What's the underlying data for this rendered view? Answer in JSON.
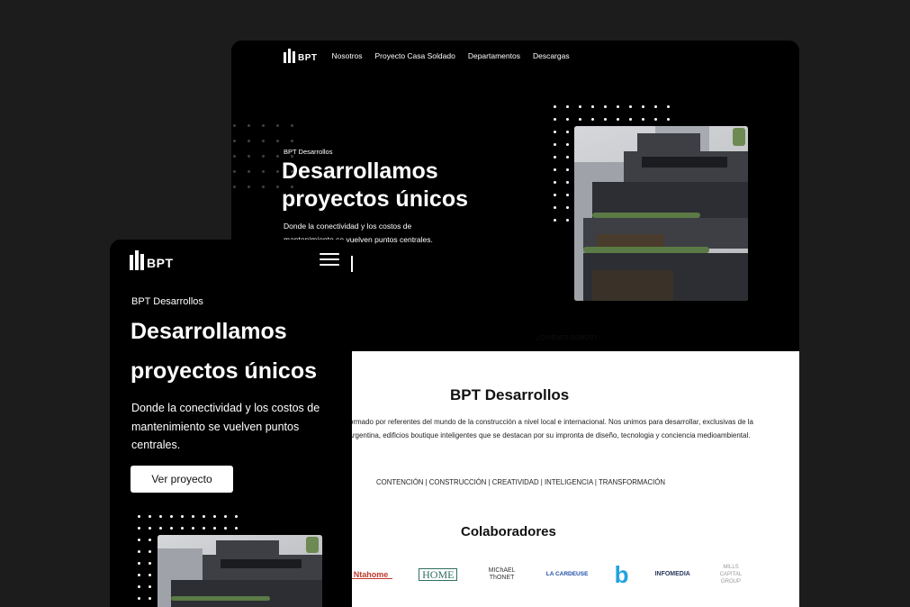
{
  "nav": {
    "logo_text": "BPT",
    "links": [
      "Nosotros",
      "Proyecto Casa Soldado",
      "Departamentos",
      "Descargas"
    ]
  },
  "hero": {
    "eyebrow": "BPT Desarrollos",
    "title_line1": "Desarrollamos",
    "title_line2": "proyectos únicos",
    "subtitle": "Donde la conectividad y los costos de mantenimiento se vuelven puntos centrales.",
    "cta_label": "Ver proyecto"
  },
  "about": {
    "eyebrow": "¿QUIÉNES SOMOS?",
    "title": "BPT Desarrollos",
    "body": "Formado por referentes del mundo de la construcción a nivel local e internacional. Nos unimos para desarrollar, exclusivas de la Argentina, edificios boutique inteligentes que se destacan por su impronta de diseño, tecnologia y conciencia medioambiental.",
    "values": "CONTENCIÓN | CONSTRUCCIÓN | CREATIVIDAD | INTELIGENCIA | TRANSFORMACIÓN"
  },
  "collaborators": {
    "title": "Colaboradores",
    "logos": [
      "Ntahome",
      "HOME",
      "MIChAEL ThONET",
      "LA CARDEUSE",
      "b",
      "INFOMEDIA",
      "MILLS CAPITAL GROUP"
    ]
  },
  "colors": {
    "background": "#1c1c1c",
    "hero_bg": "#000000",
    "text_light": "#ffffff",
    "section_bg": "#ffffff"
  },
  "icons": {
    "menu": "hamburger-menu-icon",
    "logo": "bpt-logo-icon"
  }
}
